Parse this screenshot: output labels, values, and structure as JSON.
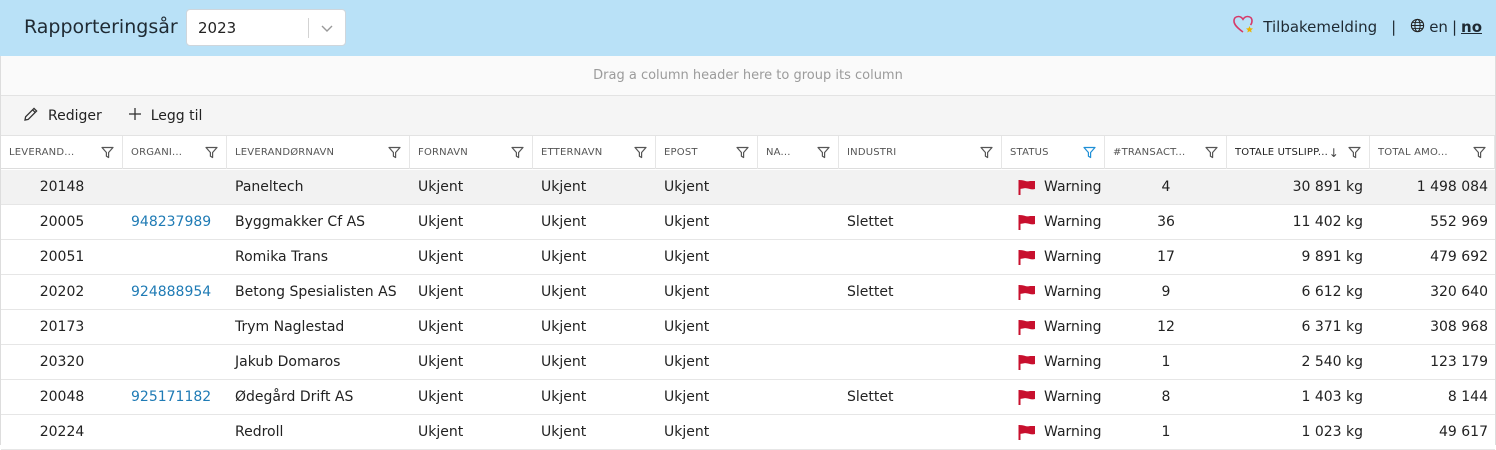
{
  "header": {
    "title": "Rapporteringsår",
    "year_value": "2023",
    "feedback_label": "Tilbakemelding",
    "separator": "|",
    "lang_en": "en",
    "lang_sep": "|",
    "lang_no": "no"
  },
  "grid": {
    "group_hint": "Drag a column header here to group its column",
    "toolbar": {
      "edit_label": "Rediger",
      "add_label": "Legg til"
    },
    "columns": [
      "LEVERAND...",
      "ORGANI...",
      "LEVERANDØRNAVN",
      "FORNAVN",
      "ETTERNAVN",
      "EPOST",
      "NA...",
      "INDUSTRI",
      "STATUS",
      "#TRANSACT...",
      "TOTALE UTSLIPP...",
      "TOTAL AMO..."
    ],
    "rows": [
      {
        "id": "20148",
        "org": "",
        "name": "Paneltech",
        "first": "Ukjent",
        "last": "Ukjent",
        "email": "Ukjent",
        "na": "",
        "industry": "",
        "status": "Warning",
        "tx": "4",
        "emissions": "30 891 kg",
        "amount": "1 498 084"
      },
      {
        "id": "20005",
        "org": "948237989",
        "name": "Byggmakker Cf AS",
        "first": "Ukjent",
        "last": "Ukjent",
        "email": "Ukjent",
        "na": "",
        "industry": "Slettet",
        "status": "Warning",
        "tx": "36",
        "emissions": "11 402 kg",
        "amount": "552 969"
      },
      {
        "id": "20051",
        "org": "",
        "name": "Romika Trans",
        "first": "Ukjent",
        "last": "Ukjent",
        "email": "Ukjent",
        "na": "",
        "industry": "",
        "status": "Warning",
        "tx": "17",
        "emissions": "9 891 kg",
        "amount": "479 692"
      },
      {
        "id": "20202",
        "org": "924888954",
        "name": "Betong Spesialisten AS",
        "first": "Ukjent",
        "last": "Ukjent",
        "email": "Ukjent",
        "na": "",
        "industry": "Slettet",
        "status": "Warning",
        "tx": "9",
        "emissions": "6 612 kg",
        "amount": "320 640"
      },
      {
        "id": "20173",
        "org": "",
        "name": "Trym Naglestad",
        "first": "Ukjent",
        "last": "Ukjent",
        "email": "Ukjent",
        "na": "",
        "industry": "",
        "status": "Warning",
        "tx": "12",
        "emissions": "6 371 kg",
        "amount": "308 968"
      },
      {
        "id": "20320",
        "org": "",
        "name": "Jakub Domaros",
        "first": "Ukjent",
        "last": "Ukjent",
        "email": "Ukjent",
        "na": "",
        "industry": "",
        "status": "Warning",
        "tx": "1",
        "emissions": "2 540 kg",
        "amount": "123 179"
      },
      {
        "id": "20048",
        "org": "925171182",
        "name": "Ødegård Drift AS",
        "first": "Ukjent",
        "last": "Ukjent",
        "email": "Ukjent",
        "na": "",
        "industry": "Slettet",
        "status": "Warning",
        "tx": "8",
        "emissions": "1 403 kg",
        "amount": "8 144"
      },
      {
        "id": "20224",
        "org": "",
        "name": "Redroll",
        "first": "Ukjent",
        "last": "Ukjent",
        "email": "Ukjent",
        "na": "",
        "industry": "",
        "status": "Warning",
        "tx": "1",
        "emissions": "1 023 kg",
        "amount": "49 617"
      }
    ]
  },
  "colors": {
    "topbar": "#b9e1f7",
    "link": "#1f7bb5",
    "flag": "#c8102e",
    "active_filter": "#1f8fd6"
  },
  "icons": {
    "feedback": "heart-star-icon",
    "globe": "globe-icon",
    "edit": "pencil-icon",
    "add": "plus-icon",
    "filter": "filter-icon",
    "flag": "flag-icon",
    "chevron": "chevron-down-icon",
    "sort": "sort-desc-icon"
  }
}
